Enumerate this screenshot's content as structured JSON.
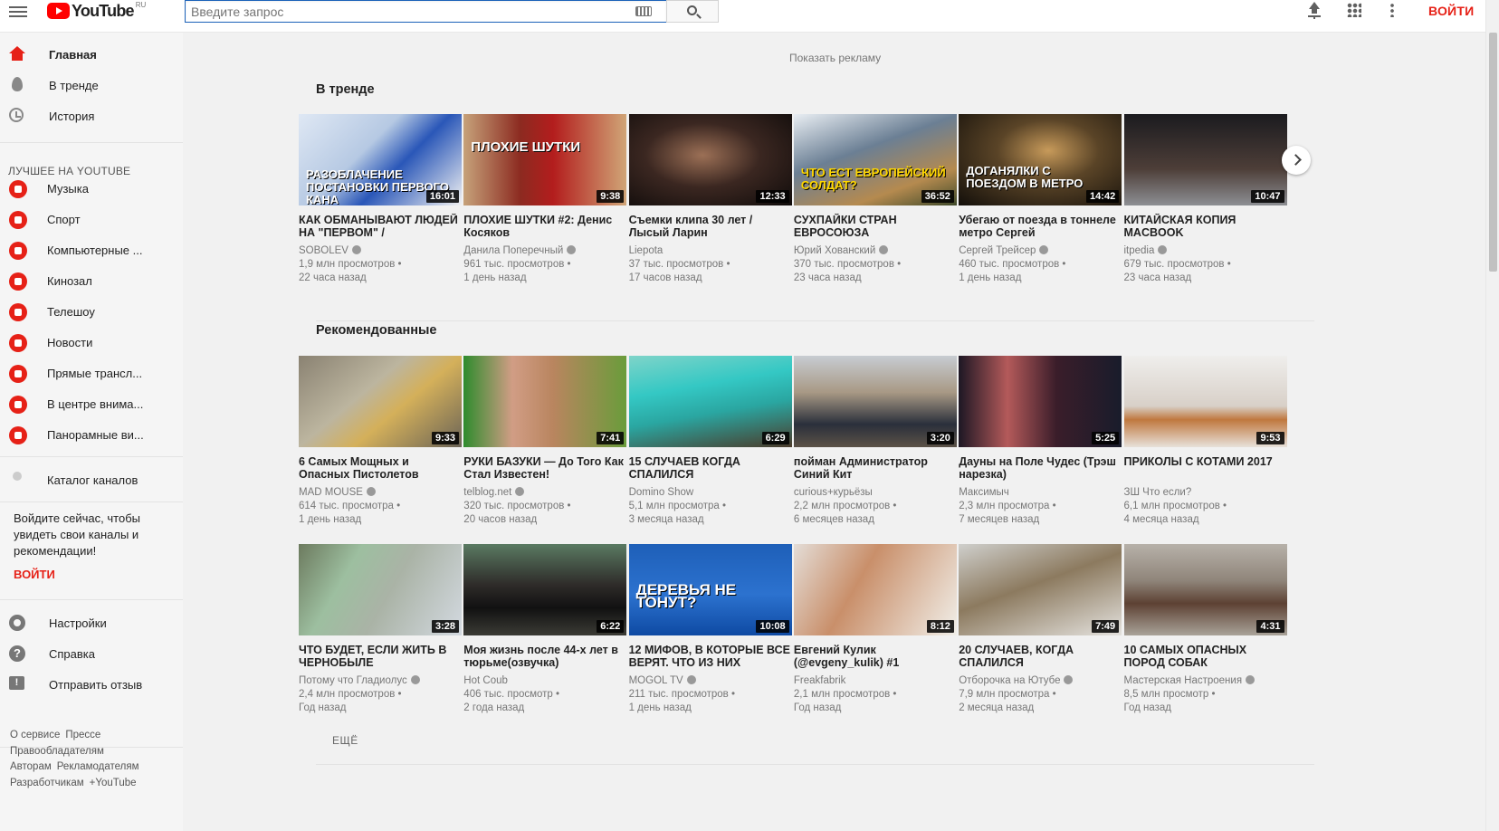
{
  "header": {
    "logo_text": "YouTube",
    "logo_country": "RU",
    "search_placeholder": "Введите запрос",
    "signin_label": "ВОЙТИ"
  },
  "sidebar": {
    "main_items": [
      {
        "label": "Главная",
        "icon": "home-icon",
        "active": true
      },
      {
        "label": "В тренде",
        "icon": "trending-icon"
      },
      {
        "label": "История",
        "icon": "history-icon"
      }
    ],
    "best_title": "ЛУЧШЕЕ НА YOUTUBE",
    "best_items": [
      {
        "label": "Музыка"
      },
      {
        "label": "Спорт"
      },
      {
        "label": "Компьютерные ..."
      },
      {
        "label": "Кинозал"
      },
      {
        "label": "Телешоу"
      },
      {
        "label": "Новости"
      },
      {
        "label": "Прямые трансл..."
      },
      {
        "label": "В центре внима..."
      },
      {
        "label": "Панорамные ви..."
      }
    ],
    "catalog_label": "Каталог каналов",
    "signin_prompt": "Войдите сейчас, чтобы увидеть свои каналы и рекомендации!",
    "signin_label": "ВОЙТИ",
    "settings_items": [
      {
        "label": "Настройки",
        "icon": "gear-icon"
      },
      {
        "label": "Справка",
        "icon": "help-icon"
      },
      {
        "label": "Отправить отзыв",
        "icon": "feedback-icon"
      }
    ],
    "footer_links": [
      "О сервисе",
      "Прессе",
      "Правообладателям",
      "Авторам",
      "Рекламодателям",
      "Разработчикам",
      "+YouTube"
    ]
  },
  "main": {
    "ad_label": "Показать рекламу",
    "trending_title": "В тренде",
    "recommended_title": "Рекомендованные",
    "more_label": "ЕЩЁ",
    "trending": [
      {
        "title": "КАК ОБМАНЫВАЮТ ЛЮДЕЙ НА \"ПЕРВОМ\" /",
        "channel": "SOBOLEV",
        "verified": true,
        "views": "1,9 млн просмотров",
        "age": "22 часа назад",
        "duration": "16:01",
        "thumb_text": "РАЗОБЛАЧЕНИЕ ПОСТАНОВКИ ПЕРВОГО КАНА"
      },
      {
        "title": "ПЛОХИЕ ШУТКИ #2: Денис Косяков",
        "channel": "Данила Поперечный",
        "verified": true,
        "views": "961 тыс. просмотров",
        "age": "1 день назад",
        "duration": "9:38",
        "thumb_text": "ПЛОХИЕ ШУТКИ"
      },
      {
        "title": "Съемки клипа 30 лет / Лысый Ларин",
        "channel": "Liepota",
        "verified": false,
        "views": "37 тыс. просмотров",
        "age": "17 часов назад",
        "duration": "12:33",
        "thumb_text": ""
      },
      {
        "title": "СУХПАЙКИ СТРАН ЕВРОСОЮЗА",
        "channel": "Юрий Хованский",
        "verified": true,
        "views": "370 тыс. просмотров",
        "age": "23 часа назад",
        "duration": "36:52",
        "thumb_text": "ЧТО ЕСТ ЕВРОПЕЙСКИЙ СОЛДАТ?"
      },
      {
        "title": "Убегаю от поезда в тоннеле метро Сергей",
        "channel": "Сергей Трейсер",
        "verified": true,
        "views": "460 тыс. просмотров",
        "age": "1 день назад",
        "duration": "14:42",
        "thumb_text": "ДОГАНЯЛКИ С ПОЕЗДОМ В МЕТРО"
      },
      {
        "title": "КИТАЙСКАЯ КОПИЯ MACBOOK",
        "channel": "itpedia",
        "verified": true,
        "views": "679 тыс. просмотров",
        "age": "23 часа назад",
        "duration": "10:47",
        "thumb_text": ""
      }
    ],
    "recommended_row1": [
      {
        "title": "6 Самых Мощных и Опасных Пистолетов",
        "channel": "MAD MOUSE",
        "verified": true,
        "views": "614 тыс. просмотра",
        "age": "1 день назад",
        "duration": "9:33"
      },
      {
        "title": "РУКИ БАЗУКИ — До Того Как Стал Известен!",
        "channel": "telblog.net",
        "verified": true,
        "views": "320 тыс. просмотров",
        "age": "20 часов назад",
        "duration": "7:41"
      },
      {
        "title": "15 СЛУЧАЕВ КОГДА СПАЛИЛСЯ",
        "channel": "Domino Show",
        "verified": false,
        "views": "5,1 млн просмотра",
        "age": "3 месяца назад",
        "duration": "6:29"
      },
      {
        "title": "пойман Администратор Синий Кит",
        "channel": "curious+курьёзы",
        "verified": false,
        "views": "2,2 млн просмотров",
        "age": "6 месяцев назад",
        "duration": "3:20"
      },
      {
        "title": "Дауны на Поле Чудес (Трэш нарезка)",
        "channel": "Максимыч",
        "verified": false,
        "views": "2,3 млн просмотра",
        "age": "7 месяцев назад",
        "duration": "5:25"
      },
      {
        "title": "ПРИКОЛЫ С КОТАМИ 2017",
        "channel": "ЗШ Что если?",
        "verified": false,
        "views": "6,1 млн просмотров",
        "age": "4 месяца назад",
        "duration": "9:53"
      }
    ],
    "recommended_row2": [
      {
        "title": "ЧТО БУДЕТ, ЕСЛИ ЖИТЬ В ЧЕРНОБЫЛЕ",
        "channel": "Потому что Гладиолус",
        "verified": true,
        "views": "2,4 млн просмотров",
        "age": "Год назад",
        "duration": "3:28"
      },
      {
        "title": "Моя жизнь после 44-х лет в тюрьме(озвучка)",
        "channel": "Hot Coub",
        "verified": false,
        "views": "406 тыс. просмотр",
        "age": "2 года назад",
        "duration": "6:22"
      },
      {
        "title": "12 МИФОВ, В КОТОРЫЕ ВСЕ ВЕРЯТ. ЧТО ИЗ НИХ",
        "channel": "MOGOL TV",
        "verified": true,
        "views": "211 тыс. просмотров",
        "age": "1 день назад",
        "duration": "10:08",
        "thumb_text": "ДЕРЕВЬЯ НЕ ТОНУТ?"
      },
      {
        "title": "Евгений Кулик (@evgeny_kulik) #1",
        "channel": "Freakfabrik",
        "verified": false,
        "views": "2,1 млн просмотров",
        "age": "Год назад",
        "duration": "8:12"
      },
      {
        "title": "20 СЛУЧАЕВ, КОГДА СПАЛИЛСЯ",
        "channel": "Отборочка на Ютубе",
        "verified": true,
        "views": "7,9 млн просмотра",
        "age": "2 месяца назад",
        "duration": "7:49"
      },
      {
        "title": "10 САМЫХ ОПАСНЫХ ПОРОД СОБАК",
        "channel": "Мастерская Настроения",
        "verified": true,
        "views": "8,5 млн просмотр",
        "age": "Год назад",
        "duration": "4:31"
      }
    ]
  },
  "colors": {
    "brand_red": "#ff0000",
    "accent_red": "#e62117",
    "link_blue": "#1c62b9"
  }
}
